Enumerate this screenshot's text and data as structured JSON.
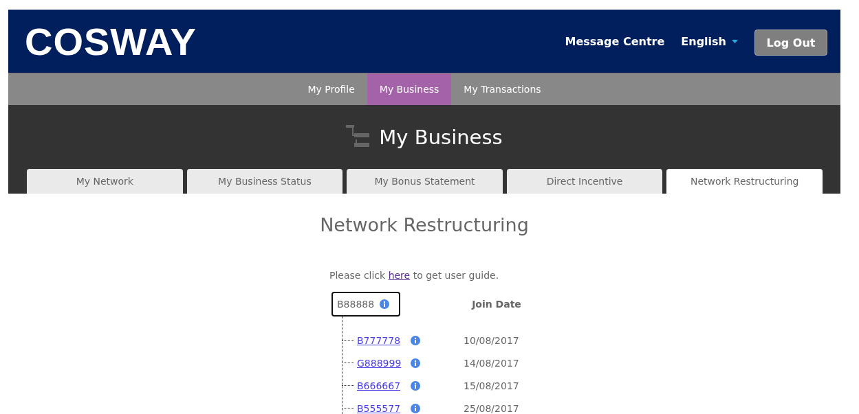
{
  "header": {
    "logo": "COSWAY",
    "links": [
      "Message Centre"
    ],
    "language": "English",
    "logout": "Log Out"
  },
  "nav": [
    {
      "label": "My Profile",
      "selected": false
    },
    {
      "label": "My Business",
      "selected": true
    },
    {
      "label": "My Transactions",
      "selected": false
    }
  ],
  "page_title": "My Business",
  "tabs": [
    {
      "label": "My Network",
      "selected": false
    },
    {
      "label": "My Business Status",
      "selected": false
    },
    {
      "label": "My Bonus Statement",
      "selected": false
    },
    {
      "label": "Direct Incentive",
      "selected": false
    },
    {
      "label": "Network Restructuring",
      "selected": true
    }
  ],
  "section_title": "Network Restructuring",
  "guide": {
    "before": "Please click ",
    "link": "here",
    "after": " to get user guide."
  },
  "tree": {
    "root": "B88888",
    "column": "Join Date",
    "children": [
      {
        "id": "B777778",
        "join_date": "10/08/2017"
      },
      {
        "id": "G888999",
        "join_date": "14/08/2017"
      },
      {
        "id": "B666667",
        "join_date": "15/08/2017"
      },
      {
        "id": "B555577",
        "join_date": "25/08/2017"
      }
    ]
  }
}
